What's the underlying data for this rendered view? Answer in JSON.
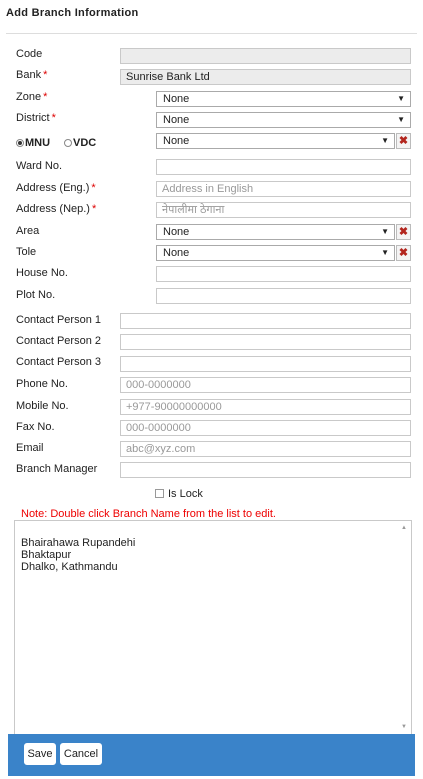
{
  "title": "Add Branch Information",
  "fields": {
    "code": {
      "label": "Code",
      "value": ""
    },
    "bank": {
      "label": "Bank",
      "value": "Sunrise Bank Ltd"
    },
    "zone": {
      "label": "Zone",
      "value": "None"
    },
    "district": {
      "label": "District",
      "value": "None"
    },
    "mnu": {
      "label": "MNU"
    },
    "vdc": {
      "label": "VDC"
    },
    "mnu_select": {
      "value": "None"
    },
    "ward": {
      "label": "Ward No.",
      "value": ""
    },
    "address_eng": {
      "label": "Address (Eng.)",
      "placeholder": "Address in English"
    },
    "address_nep": {
      "label": "Address (Nep.)",
      "placeholder": "नेपालीमा ठेगाना"
    },
    "area": {
      "label": "Area",
      "value": "None"
    },
    "tole": {
      "label": "Tole",
      "value": "None"
    },
    "house": {
      "label": "House No.",
      "value": ""
    },
    "plot": {
      "label": "Plot No.",
      "value": ""
    },
    "contact1": {
      "label": "Contact Person 1",
      "value": ""
    },
    "contact2": {
      "label": "Contact Person 2",
      "value": ""
    },
    "contact3": {
      "label": "Contact Person 3",
      "value": ""
    },
    "phone": {
      "label": "Phone No.",
      "placeholder": "000-0000000"
    },
    "mobile": {
      "label": "Mobile No.",
      "placeholder": "+977-90000000000"
    },
    "fax": {
      "label": "Fax No.",
      "placeholder": "000-0000000"
    },
    "email": {
      "label": "Email",
      "placeholder": "abc@xyz.com"
    },
    "manager": {
      "label": "Branch Manager",
      "value": ""
    }
  },
  "required_mark": "*",
  "is_lock": "Is Lock",
  "note": "Note: Double click Branch Name from the list to edit.",
  "branch_list": [
    "Bhairahawa Rupandehi",
    "Bhaktapur",
    "Dhalko, Kathmandu"
  ],
  "buttons": {
    "save": "Save",
    "cancel": "Cancel"
  },
  "colors": {
    "required": "#dd0000",
    "footer": "#3a83c9",
    "tool_icon": "#b3261e"
  },
  "icons": {
    "tool": "tools-icon",
    "dropdown": "caret-down-icon"
  }
}
